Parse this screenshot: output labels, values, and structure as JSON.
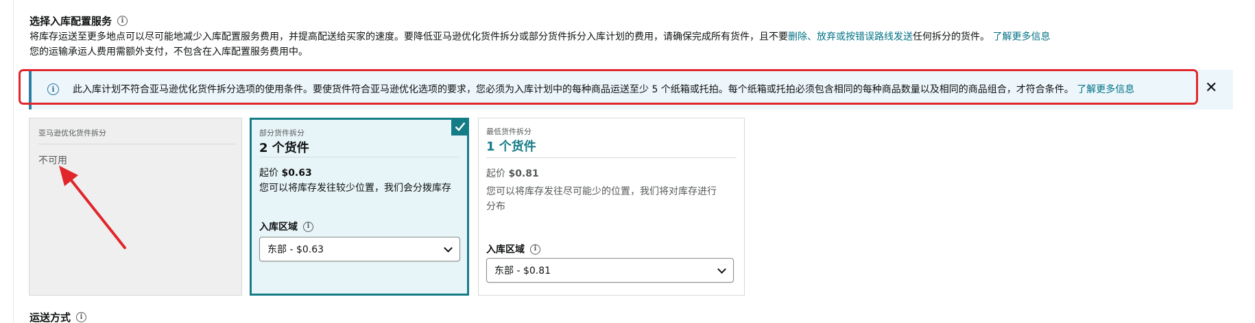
{
  "section": {
    "title": "选择入库配置服务",
    "desc_line1_a": "将库存运送至更多地点可以尽可能地减少入库配置服务费用，并提高配送给买家的速度。要降低亚马逊优化货件拆分或部分货件拆分入库计划的费用，请确保完成所有货件，且不要",
    "desc_line1_link": "删除、放弃或按错误路线发送",
    "desc_line1_b": "任何拆分的货件。",
    "desc_line1_learn_more": "了解更多信息",
    "desc_line2": "您的运输承运人费用需额外支付，不包含在入库配置服务费用中。"
  },
  "alert": {
    "text": "此入库计划不符合亚马逊优化货件拆分选项的使用条件。要使货件符合亚马逊优化选项的要求，您必须为入库计划中的每种商品运送至少 5 个纸箱或托拍。每个纸箱或托拍必须包含相同的每种商品数量以及相同的商品组合，才符合条件。",
    "learn_more": "了解更多信息",
    "close_icon": "close-icon"
  },
  "cards": {
    "amazon_optimized": {
      "label": "亚马逊优化货件拆分",
      "status": "不可用"
    },
    "partial": {
      "label": "部分货件拆分",
      "title": "2 个货件",
      "price_prefix": "起价 ",
      "price": "$0.63",
      "desc": "您可以将库存发往较少位置，我们会分拨库存",
      "region_label": "入库区域",
      "region_value": "东部 - $0.63",
      "selected": true
    },
    "minimal": {
      "label": "最低货件拆分",
      "title": "1 个货件",
      "price_prefix": "起价 ",
      "price": "$0.81",
      "desc_line1": "您可以将库存发往尽可能少的位置，我们将对库存进行",
      "desc_line2": "分布",
      "region_label": "入库区域",
      "region_value": "东部 - $0.81"
    }
  },
  "shipping": {
    "title": "运送方式"
  },
  "colors": {
    "accent": "#147c87",
    "link": "#007185",
    "annotation_red": "#e0262b",
    "alert_bg": "#edf6fb"
  }
}
